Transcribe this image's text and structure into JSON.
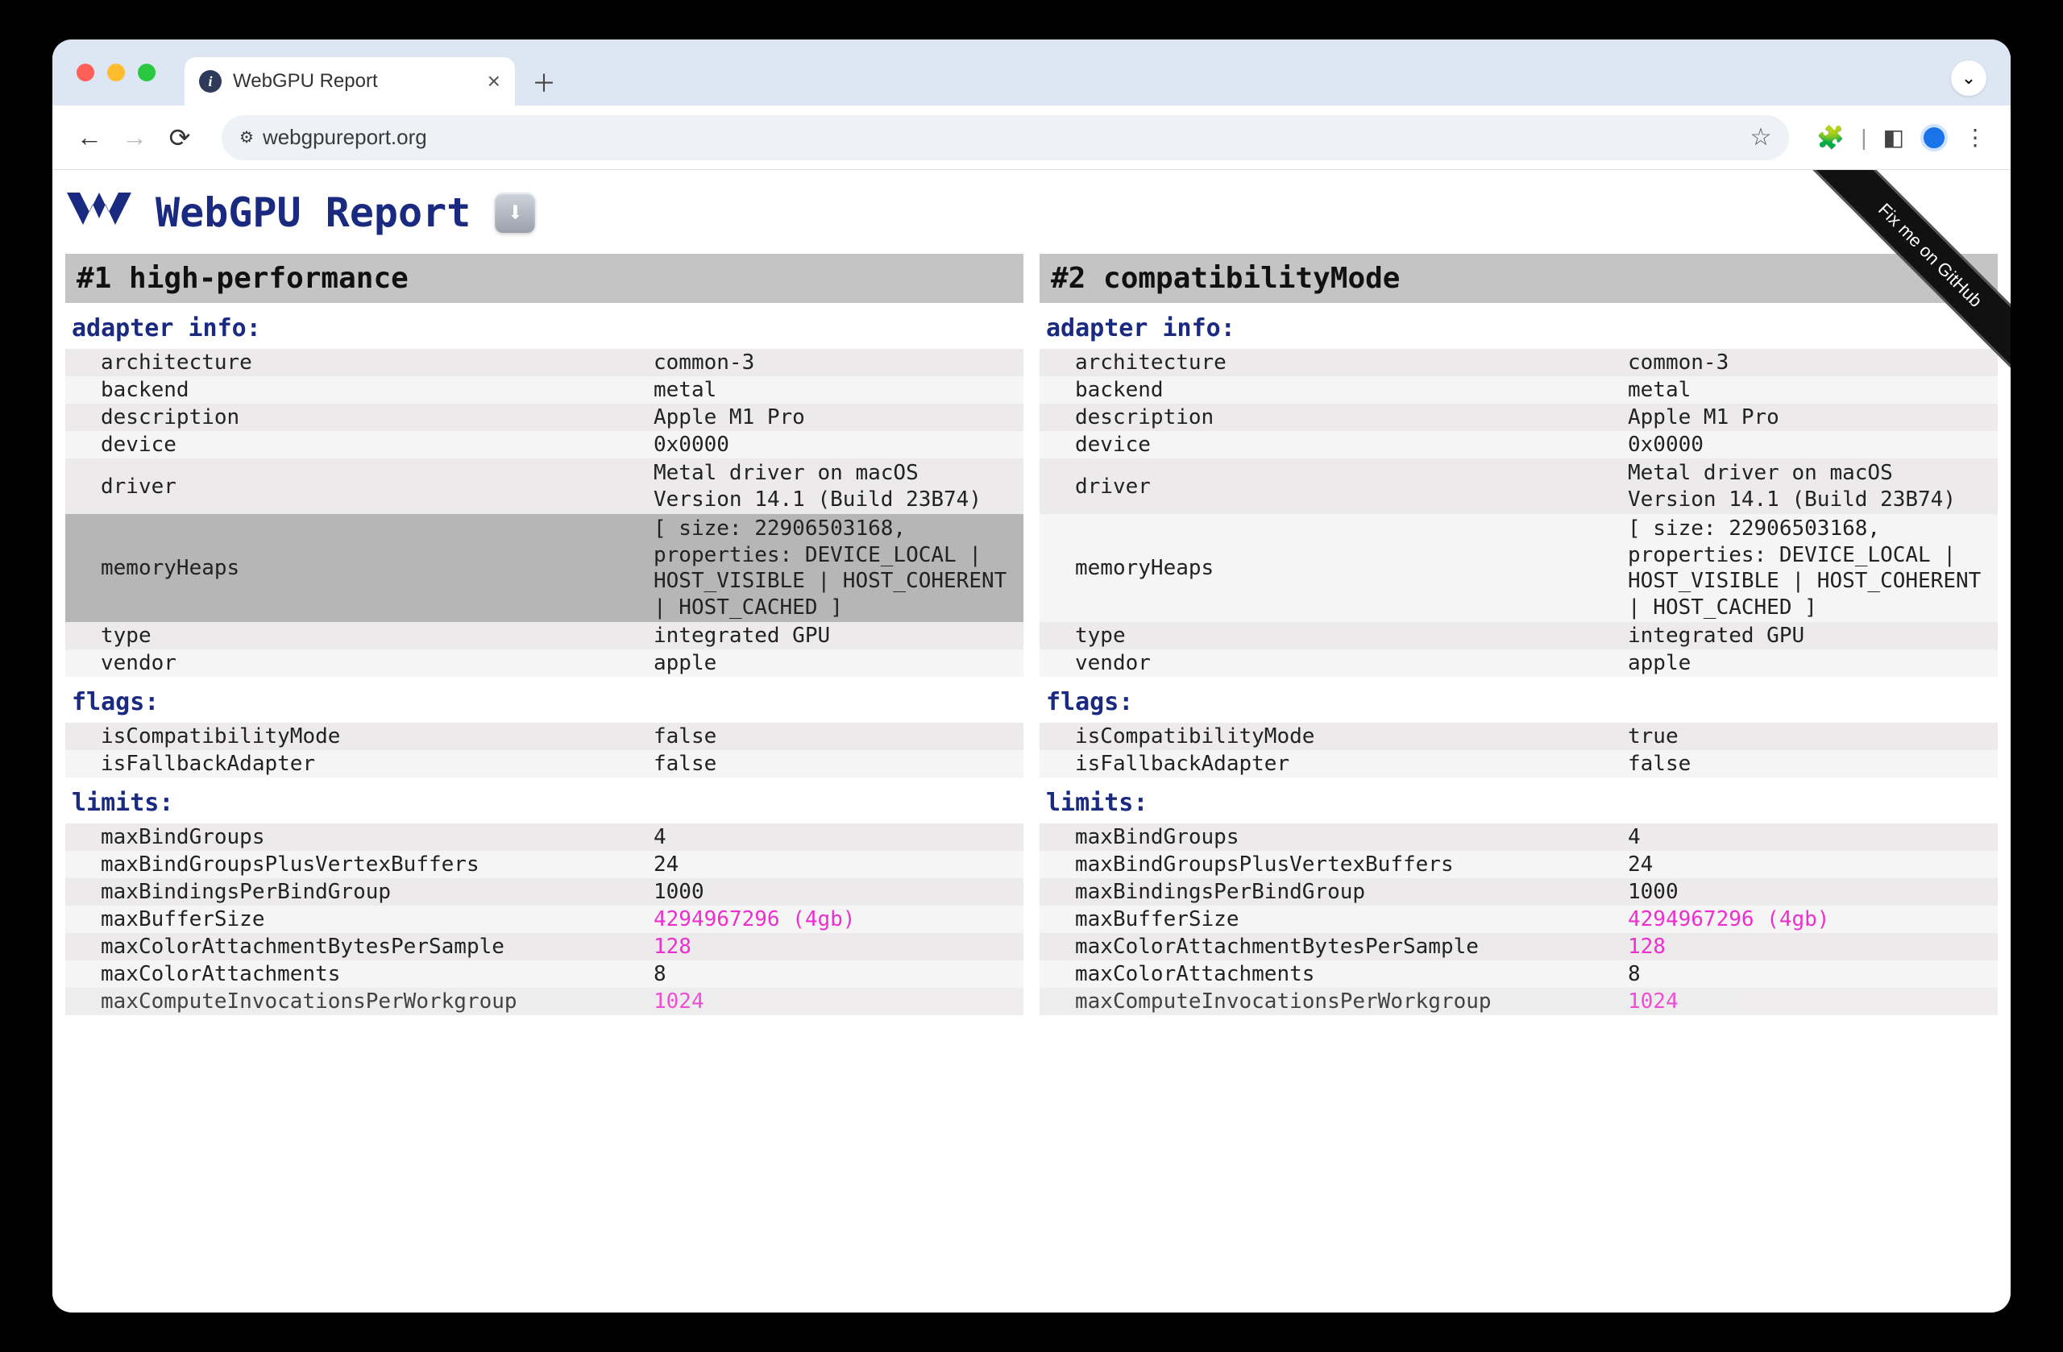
{
  "browser": {
    "tab_title": "WebGPU Report",
    "url": "webgpureport.org"
  },
  "page": {
    "title": "WebGPU Report",
    "github_ribbon": "Fix me on GitHub",
    "download_icon": "⬇"
  },
  "panels": [
    {
      "id": "p1",
      "heading": "#1 high-performance",
      "sections": [
        {
          "title": "adapter info:",
          "rows": [
            {
              "k": "architecture",
              "v": "common-3"
            },
            {
              "k": "backend",
              "v": "metal"
            },
            {
              "k": "description",
              "v": "Apple M1 Pro"
            },
            {
              "k": "device",
              "v": "0x0000"
            },
            {
              "k": "driver",
              "v": "Metal driver on macOS Version 14.1 (Build 23B74)",
              "multi": true
            },
            {
              "k": "memoryHeaps",
              "v": "[ size: 22906503168, properties: DEVICE_LOCAL | HOST_VISIBLE | HOST_COHERENT | HOST_CACHED ]",
              "multi": true,
              "hl": true
            },
            {
              "k": "type",
              "v": "integrated GPU"
            },
            {
              "k": "vendor",
              "v": "apple"
            }
          ]
        },
        {
          "title": "flags:",
          "rows": [
            {
              "k": "isCompatibilityMode",
              "v": "false"
            },
            {
              "k": "isFallbackAdapter",
              "v": "false"
            }
          ]
        },
        {
          "title": "limits:",
          "rows": [
            {
              "k": "maxBindGroups",
              "v": "4"
            },
            {
              "k": "maxBindGroupsPlusVertexBuffers",
              "v": "24"
            },
            {
              "k": "maxBindingsPerBindGroup",
              "v": "1000"
            },
            {
              "k": "maxBufferSize",
              "v": "4294967296 (4gb)",
              "pink": true
            },
            {
              "k": "maxColorAttachmentBytesPerSample",
              "v": "128",
              "pink": true
            },
            {
              "k": "maxColorAttachments",
              "v": "8"
            },
            {
              "k": "maxComputeInvocationsPerWorkgroup",
              "v": "1024",
              "pink": true,
              "cut": true
            }
          ]
        }
      ]
    },
    {
      "id": "p2",
      "heading": "#2 compatibilityMode",
      "sections": [
        {
          "title": "adapter info:",
          "rows": [
            {
              "k": "architecture",
              "v": "common-3"
            },
            {
              "k": "backend",
              "v": "metal"
            },
            {
              "k": "description",
              "v": "Apple M1 Pro"
            },
            {
              "k": "device",
              "v": "0x0000"
            },
            {
              "k": "driver",
              "v": "Metal driver on macOS Version 14.1 (Build 23B74)",
              "multi": true
            },
            {
              "k": "memoryHeaps",
              "v": "[ size: 22906503168, properties: DEVICE_LOCAL | HOST_VISIBLE | HOST_COHERENT | HOST_CACHED ]",
              "multi": true
            },
            {
              "k": "type",
              "v": "integrated GPU"
            },
            {
              "k": "vendor",
              "v": "apple"
            }
          ]
        },
        {
          "title": "flags:",
          "rows": [
            {
              "k": "isCompatibilityMode",
              "v": "true"
            },
            {
              "k": "isFallbackAdapter",
              "v": "false"
            }
          ]
        },
        {
          "title": "limits:",
          "rows": [
            {
              "k": "maxBindGroups",
              "v": "4"
            },
            {
              "k": "maxBindGroupsPlusVertexBuffers",
              "v": "24"
            },
            {
              "k": "maxBindingsPerBindGroup",
              "v": "1000"
            },
            {
              "k": "maxBufferSize",
              "v": "4294967296 (4gb)",
              "pink": true
            },
            {
              "k": "maxColorAttachmentBytesPerSample",
              "v": "128",
              "pink": true
            },
            {
              "k": "maxColorAttachments",
              "v": "8"
            },
            {
              "k": "maxComputeInvocationsPerWorkgroup",
              "v": "1024",
              "pink": true,
              "cut": true
            }
          ]
        }
      ]
    }
  ]
}
